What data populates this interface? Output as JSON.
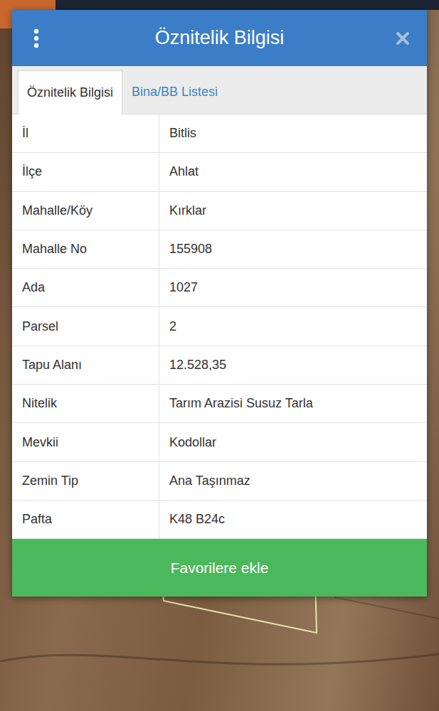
{
  "dialog": {
    "title": "Öznitelik Bilgisi"
  },
  "tabs": [
    {
      "label": "Öznitelik Bilgisi",
      "selected": true
    },
    {
      "label": "Bina/BB Listesi",
      "selected": false
    }
  ],
  "attributes": [
    {
      "key": "İl",
      "value": "Bitlis"
    },
    {
      "key": "İlçe",
      "value": "Ahlat"
    },
    {
      "key": "Mahalle/Köy",
      "value": "Kırklar"
    },
    {
      "key": "Mahalle No",
      "value": "155908"
    },
    {
      "key": "Ada",
      "value": "1027"
    },
    {
      "key": "Parsel",
      "value": "2"
    },
    {
      "key": "Tapu Alanı",
      "value": "12.528,35"
    },
    {
      "key": "Nitelik",
      "value": "Tarım Arazisi Susuz Tarla"
    },
    {
      "key": "Mevkii",
      "value": "Kodollar"
    },
    {
      "key": "Zemin Tip",
      "value": "Ana Taşınmaz"
    },
    {
      "key": "Pafta",
      "value": "K48 B24c"
    }
  ],
  "buttons": [
    "Favorilere ekle"
  ]
}
